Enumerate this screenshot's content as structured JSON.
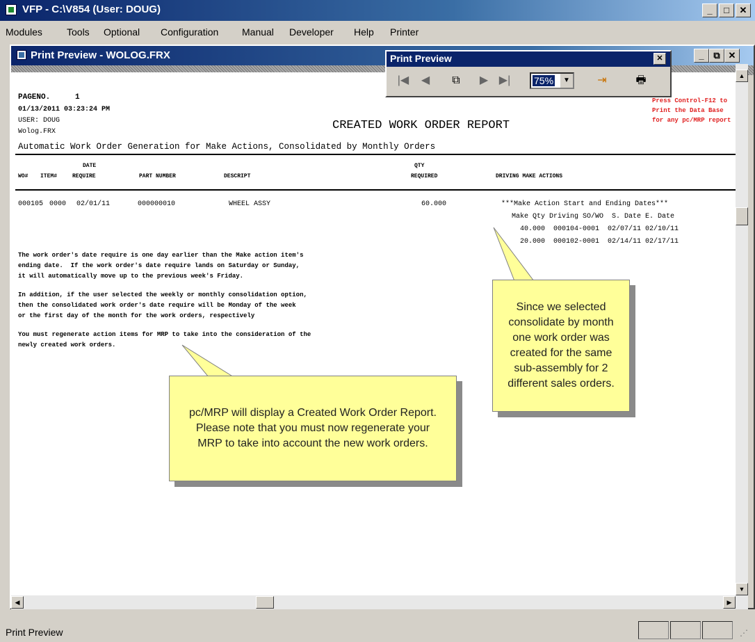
{
  "window": {
    "title": "VFP - C:\\V854 (User: DOUG)"
  },
  "menu": [
    "Modules",
    "Tools",
    "Optional",
    "Configuration",
    "Manual",
    "Developer",
    "Help",
    "Printer"
  ],
  "child": {
    "title": "Print Preview - WOLOG.FRX"
  },
  "toolbar": {
    "title": "Print Preview",
    "zoom": "75%"
  },
  "report": {
    "page_label": "PAGENO.",
    "page_no": "1",
    "timestamp": "01/13/2011 03:23:24 PM",
    "user": "USER: DOUG",
    "file": "Wolog.FRX",
    "title": "CREATED WORK ORDER REPORT",
    "hint_lines": [
      "Press Control-F12 to",
      "Print the Data Base",
      "for any pc/MRP report"
    ],
    "subtitle": "Automatic Work Order Generation for Make Actions, Consolidated by Monthly Orders",
    "columns": {
      "wo": "WO#",
      "item": "ITEM#",
      "date_top": "DATE",
      "date_bottom": "REQUIRE",
      "part": "PART NUMBER",
      "desc": "DESCRIPT",
      "qty_top": "QTY",
      "qty_bottom": "REQUIRED",
      "driving": "DRIVING MAKE ACTIONS"
    },
    "row": {
      "wo": "000105",
      "item": "0000",
      "date": "02/01/11",
      "part": "000000010",
      "desc": "WHEEL ASSY",
      "qty": "60.000"
    },
    "driving_lines": [
      "***Make Action Start and Ending Dates***",
      "Make Qty Driving SO/WO  S. Date E. Date",
      "  40.000  000104-0001  02/07/11 02/10/11",
      "  20.000  000102-0001  02/14/11 02/17/11"
    ],
    "note1": [
      "The work order's date require is one day earlier than the Make action item's",
      "ending date.  If the work order's date require lands on Saturday or Sunday,",
      "it will automatically move up to the previous week's Friday."
    ],
    "note2": [
      "In addition, if the user selected the weekly or monthly consolidation option,",
      "then the consolidated work order's date require will be Monday of the week",
      "or the first day of the month for the work orders, respectively"
    ],
    "note3": [
      "You must regenerate action items for MRP to take into the consideration of the",
      "newly created work orders."
    ]
  },
  "callouts": {
    "right": "Since we selected consolidate by month one work order was created for the same sub-assembly for 2 different sales orders.",
    "center": "pc/MRP will display a Created Work Order Report.   Please note that you must now regenerate your MRP to take into account the new work orders."
  },
  "status": {
    "text": "Print Preview"
  }
}
